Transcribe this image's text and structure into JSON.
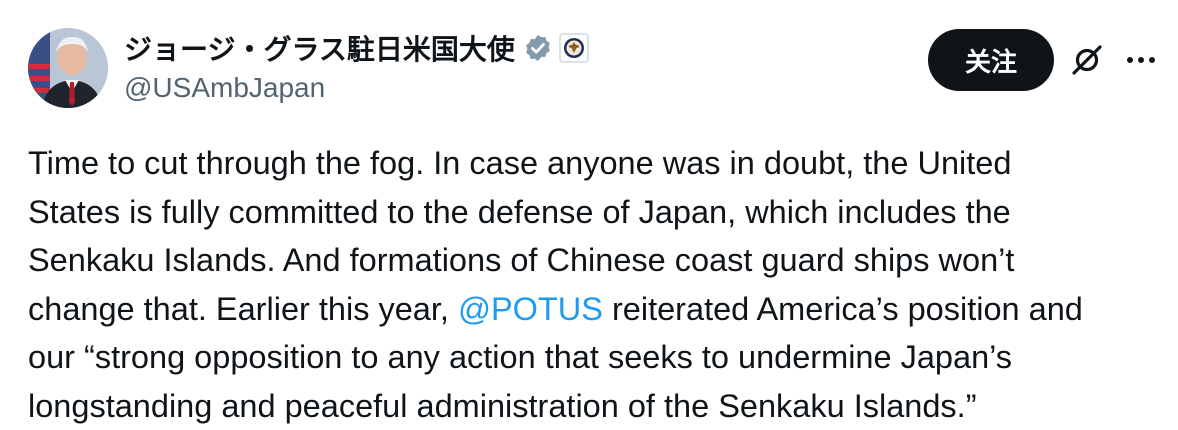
{
  "author": {
    "display_name": "ジョージ・グラス駐日米国大使",
    "handle": "@USAmbJapan",
    "verified_icon": "verified-badge-icon",
    "affiliation_icon": "state-department-seal-icon"
  },
  "actions": {
    "follow_label": "关注",
    "grok_icon": "grok-icon",
    "more_icon": "more-options-icon"
  },
  "tweet": {
    "lines": [
      {
        "text": "Time to cut through the fog. In case anyone was in doubt, the United"
      },
      {
        "text": "States is fully committed to the defense of Japan, which includes the"
      },
      {
        "text": "Senkaku Islands. And formations of Chinese coast guard ships won’t"
      },
      {
        "before": "change that. Earlier this year, ",
        "mention": "@POTUS",
        "after": " reiterated America’s position and"
      },
      {
        "text": "our “strong opposition to any action that seeks to undermine Japan’s"
      },
      {
        "text": "longstanding and peaceful administration of the Senkaku Islands.”"
      }
    ]
  },
  "colors": {
    "text": "#0f1419",
    "secondary": "#536471",
    "link": "#1d9bf0",
    "verified": "#829aab",
    "button": "#0f1419"
  }
}
